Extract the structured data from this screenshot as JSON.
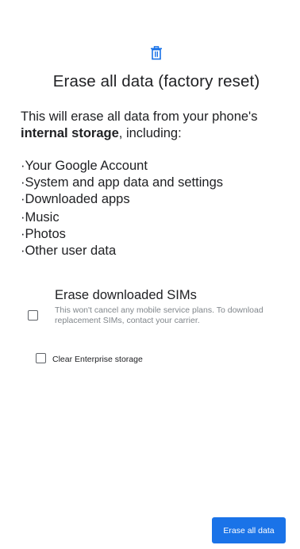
{
  "header": {
    "icon": "trash-icon",
    "accent_color": "#1a73e8",
    "title": "Erase all data (factory reset)"
  },
  "description": {
    "prefix": "This will erase all data from your phone's ",
    "bold": "internal storage",
    "suffix": ", including:"
  },
  "items": [
    "Your Google Account",
    "System and app data and settings",
    "Downloaded apps",
    "Music",
    "Photos",
    "Other user data"
  ],
  "erase_sims": {
    "title": "Erase downloaded SIMs",
    "description": "This won't cancel any mobile service plans. To download replacement SIMs, contact your carrier.",
    "checked": false
  },
  "clear_enterprise": {
    "label": "Clear Enterprise storage",
    "checked": false
  },
  "primary_button": {
    "label": "Erase all data",
    "color": "#1a73e8"
  }
}
